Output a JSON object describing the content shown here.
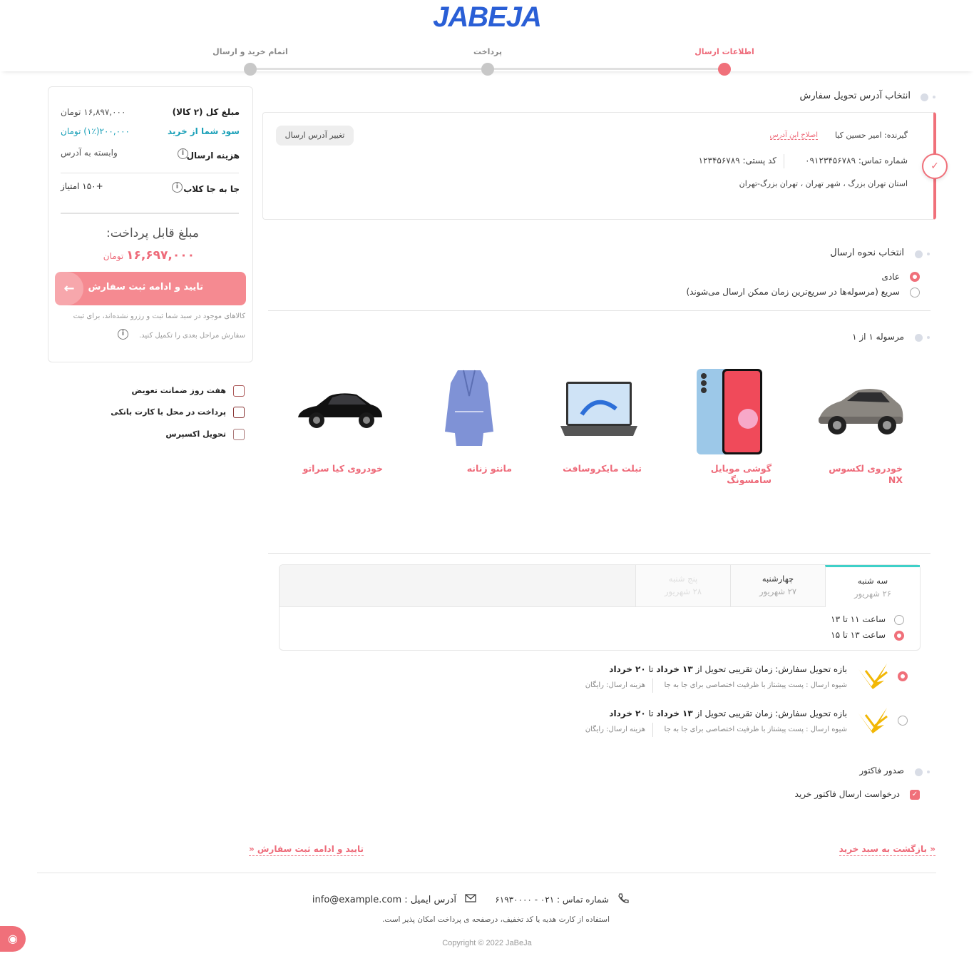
{
  "header": {
    "logo": "JABEJA",
    "steps": [
      {
        "label": "اطلاعات ارسال",
        "active": true
      },
      {
        "label": "پرداخت",
        "active": false
      },
      {
        "label": "اتمام خرید و ارسال",
        "active": false
      }
    ]
  },
  "summary": {
    "total_label": "مبلغ کل (۲ کالا)",
    "total_value": "۱۶,۸۹۷,۰۰۰ تومان",
    "profit_label": "سود شما از خرید",
    "profit_value": "۲۰۰,۰۰۰(۱٪) تومان",
    "shipping_label": "هزینه ارسال",
    "shipping_value": "وابسته به آدرس",
    "club_label": "جا به جا کلاب",
    "club_value": "+۱۵۰ امتیاز",
    "payable_label": "مبلغ قابل پرداخت:",
    "payable_amount": "۱۶,۶۹۷,۰۰۰",
    "payable_currency": "تومان",
    "confirm_button": "تایید و ادامه ثبت سفارش",
    "note_line1": "کالاهای موجود در سبد شما ثبت و رزرو نشده‌اند، برای ثبت",
    "note_line2": "سفارش مراحل بعدی را تکمیل کنید."
  },
  "features": [
    {
      "label": "هفت روز ضمانت تعویض",
      "icon": "exchange-icon"
    },
    {
      "label": "پرداخت در محل با کارت بانکی",
      "icon": "card-pos-icon"
    },
    {
      "label": "تحویل اکسپرس",
      "icon": "express-box-icon"
    }
  ],
  "address": {
    "section_title": "انتخاب آدرس تحویل سفارش",
    "recipient": "گیرنده: امیر حسین کیا",
    "edit_link": "اصلاح این آدرس",
    "phone": "شماره تماس: ۰۹۱۲۳۴۵۶۷۸۹",
    "postal": "کد پستی: ۱۲۳۴۵۶۷۸۹",
    "full": "استان تهران بزرگ ، شهر تهران ، تهران بزرگ-تهران",
    "change_button": "تغییر آدرس ارسال"
  },
  "shipping_method": {
    "section_title": "انتخاب نحوه ارسال",
    "options": [
      {
        "label": "عادی",
        "selected": true
      },
      {
        "label": "سریع (مرسوله‌ها در سریع‌ترین زمان ممکن ارسال می‌شوند)",
        "selected": false
      }
    ]
  },
  "parcel": {
    "section_title": "مرسوله ۱ از ۱",
    "products": [
      {
        "name_line1": "خودروی لکسوس",
        "name_line2": "NX"
      },
      {
        "name_line1": "گوشی موبایل",
        "name_line2": "سامسونگ"
      },
      {
        "name_line1": "تبلت مایکروسافت",
        "name_line2": ""
      },
      {
        "name_line1": "مانتو زنانه",
        "name_line2": ""
      },
      {
        "name_line1": "خودروی کیا سراتو",
        "name_line2": ""
      }
    ]
  },
  "schedule": {
    "days": [
      {
        "day": "سه شنبه",
        "date": "۲۶ شهریور",
        "active": true,
        "disabled": false
      },
      {
        "day": "چهارشنبه",
        "date": "۲۷ شهریور",
        "active": false,
        "disabled": false
      },
      {
        "day": "پنج شنبه",
        "date": "۲۸ شهریور",
        "active": false,
        "disabled": true
      }
    ],
    "slots": [
      {
        "label": "ساعت ۱۱ تا ۱۳",
        "selected": false
      },
      {
        "label": "ساعت ۱۳ تا ۱۵",
        "selected": true
      }
    ]
  },
  "delivery_options": [
    {
      "title_prefix": "بازه تحویل سفارش: زمان تقریبی تحویل از ",
      "from": "۱۳ خرداد",
      "middle": " تا ",
      "to": "۲۰ خرداد",
      "method": "شیوه ارسال : پست پیشتاز با ظرفیت اختصاصی برای جا به جا",
      "cost": "هزینه ارسال: رایگان",
      "selected": true
    },
    {
      "title_prefix": "بازه تحویل سفارش: زمان تقریبی تحویل از ",
      "from": "۱۳ خرداد",
      "middle": " تا ",
      "to": "۲۰ خرداد",
      "method": "شیوه ارسال : پست پیشتاز با ظرفیت اختصاصی برای جا به جا",
      "cost": "هزینه ارسال: رایگان",
      "selected": false
    }
  ],
  "invoice": {
    "section_title": "صدور فاکتور",
    "checkbox_label": "درخواست ارسال فاکتور خرید",
    "checked": true
  },
  "nav": {
    "back": "« بازگشت به سبد خرید",
    "next": "تایید و ادامه ثبت سفارش «"
  },
  "footer": {
    "phone": "شماره تماس : ۰۲۱ - ۶۱۹۳۰۰۰۰",
    "email": "آدرس ایمیل : info@example.com",
    "note": "استفاده از کارت هدیه یا کد تخفیف، درصفحه ی پرداخت امکان پذیر است.",
    "copyright": "Copyright © 2022 JaBeJa"
  },
  "colors": {
    "accent": "#f0707a",
    "brand": "#2a5fd6",
    "teal": "#1aa0b8"
  }
}
